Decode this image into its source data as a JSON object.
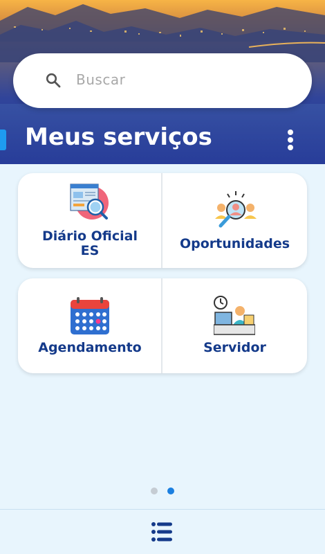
{
  "search": {
    "placeholder": "Buscar",
    "icon": "search-icon"
  },
  "header": {
    "title": "Meus serviços",
    "menu_icon": "more-vert-icon"
  },
  "services": [
    {
      "label": "Diário Oficial ES",
      "icon": "newspaper-search-icon"
    },
    {
      "label": "Oportunidades",
      "icon": "recruitment-icon"
    },
    {
      "label": "Agendamento",
      "icon": "calendar-icon"
    },
    {
      "label": "Servidor",
      "icon": "employee-desk-icon"
    }
  ],
  "pager": {
    "pages": 2,
    "active_index": 1
  },
  "bottom_nav": {
    "icon": "menu-icon"
  },
  "colors": {
    "accent": "#1e9bf0",
    "label": "#143a8a",
    "background": "#e8f5fd",
    "dot_active": "#1b7fe0",
    "dot_inactive": "#c5ccd3"
  }
}
